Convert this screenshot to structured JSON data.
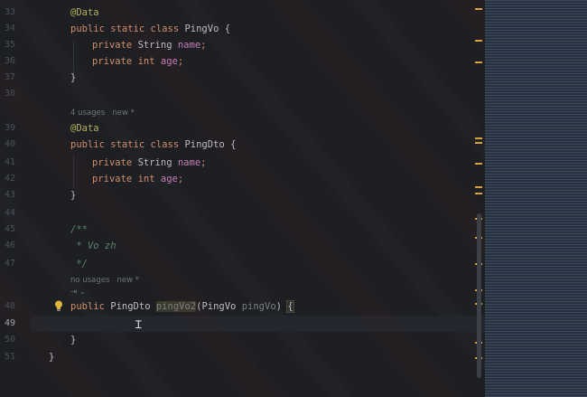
{
  "gutter": {
    "line_numbers": [
      "33",
      "34",
      "35",
      "36",
      "37",
      "38",
      "39",
      "40",
      "41",
      "42",
      "43",
      "44",
      "45",
      "46",
      "47",
      "48",
      "49",
      "50",
      "51"
    ]
  },
  "code": {
    "l33_annotation": "@Data",
    "l34_public": "public",
    "l34_static": "static",
    "l34_class": "class",
    "l34_name": "PingVo",
    "l34_brace": "{",
    "l35_private": "private",
    "l35_type": "String",
    "l35_field": "name",
    "l35_semi": ";",
    "l36_private": "private",
    "l36_type": "int",
    "l36_field": "age",
    "l36_semi": ";",
    "l37_brace": "}",
    "inlay_1": "4 usages   new *",
    "l39_annotation": "@Data",
    "l40_public": "public",
    "l40_static": "static",
    "l40_class": "class",
    "l40_name": "PingDto",
    "l40_brace": "{",
    "l41_private": "private",
    "l41_type": "String",
    "l41_field": "name",
    "l41_semi": ";",
    "l42_private": "private",
    "l42_type": "int",
    "l42_field": "age",
    "l42_semi": ";",
    "l43_brace": "}",
    "l45_doc": "/**",
    "l46_doc": " * Vo zh",
    "l47_doc": " */",
    "inlay_2": "no usages   new *",
    "inlay_3": "⇥ ⌄",
    "l48_public": "public",
    "l48_ret": "PingDto",
    "l48_method": "pingVo2",
    "l48_open": "(",
    "l48_ptype": "PingVo",
    "l48_pname": "pingVo",
    "l48_close": ")",
    "l48_brace": "{",
    "l50_brace": "}",
    "l51_brace": "}"
  },
  "icons": {
    "intention": "lightbulb-icon",
    "cursor": "text-cursor-icon"
  },
  "colors": {
    "background": "#1e1f22",
    "keyword": "#cf8e6d",
    "annotation": "#b3ae60",
    "field": "#c77dbb",
    "doc_comment": "#5f826b",
    "marker": "#d6a23a",
    "minimap": "#26313f"
  }
}
